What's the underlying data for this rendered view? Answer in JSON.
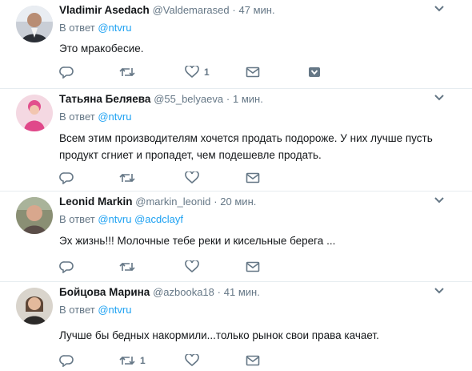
{
  "colors": {
    "accent": "#1da1f2",
    "secondary": "#657786",
    "text": "#14171a",
    "divider": "#e6ecf0"
  },
  "tweets": [
    {
      "name": "Vladimir Asedach",
      "handle": "@Valdemarased",
      "dot": "·",
      "time": "47 мин.",
      "reply_label": "В ответ",
      "mentions": [
        "@ntvru"
      ],
      "text": "Это мракобесие.",
      "actions": {
        "reply_count": "",
        "retweet_count": "",
        "like_count": "1"
      },
      "icons": [
        "reply-icon",
        "retweet-icon",
        "heart-icon",
        "envelope-icon",
        "chevron-down-icon"
      ]
    },
    {
      "name": "Татьяна Беляева",
      "handle": "@55_belyaeva",
      "dot": "·",
      "time": "1 мин.",
      "reply_label": "В ответ",
      "mentions": [
        "@ntvru"
      ],
      "text_lines": [
        "Всем этим производителям хочется продать подороже. У них лучше пусть",
        "продукт сгниет и пропадет, чем подешевле продать."
      ],
      "actions": {
        "reply_count": "",
        "retweet_count": "",
        "like_count": ""
      },
      "icons": [
        "reply-icon",
        "retweet-icon",
        "heart-icon",
        "envelope-icon",
        "chevron-down-icon"
      ]
    },
    {
      "name": "Leonid Markin",
      "handle": "@markin_leonid",
      "dot": "·",
      "time": "20 мин.",
      "reply_label": "В ответ",
      "mentions": [
        "@ntvru",
        "@acdclayf"
      ],
      "text": "Эх жизнь!!! Молочные тебе реки и кисельные берега ...",
      "actions": {
        "reply_count": "",
        "retweet_count": "",
        "like_count": ""
      },
      "icons": [
        "reply-icon",
        "retweet-icon",
        "heart-icon",
        "envelope-icon",
        "chevron-down-icon"
      ]
    },
    {
      "name": "Бойцова Марина",
      "handle": "@azbooka18",
      "dot": "·",
      "time": "41 мин.",
      "reply_label": "В ответ",
      "mentions": [
        "@ntvru"
      ],
      "text": "Лучше бы бедных накормили...только рынок свои права качает.",
      "actions": {
        "reply_count": "",
        "retweet_count": "1",
        "like_count": ""
      },
      "icons": [
        "reply-icon",
        "retweet-icon",
        "heart-icon",
        "envelope-icon",
        "chevron-down-icon"
      ]
    }
  ]
}
